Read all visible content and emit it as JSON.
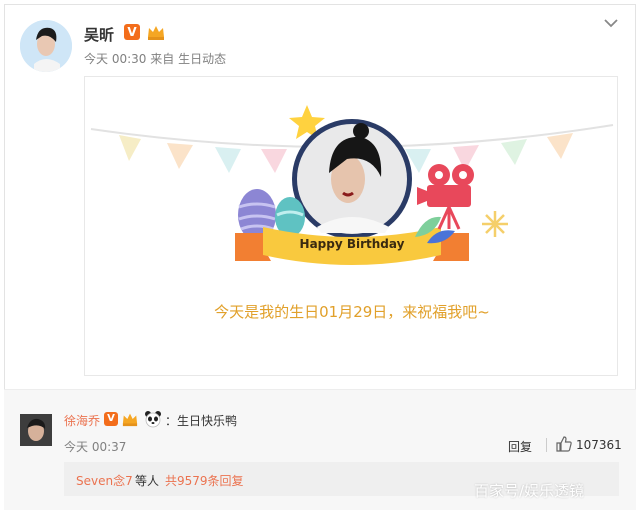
{
  "post": {
    "author": "吴昕",
    "verified_badge": "V",
    "time": "今天 00:30",
    "source_prefix": "来自",
    "source": "生日动态",
    "options_icon": "chevron-down-icon"
  },
  "card": {
    "banner_text": "Happy Birthday",
    "message": "今天是我的生日01月29日，来祝福我吧~"
  },
  "comment": {
    "author": "徐海乔",
    "verified_badge": "V",
    "text": "：生日快乐鸭",
    "time": "今天 00:37",
    "reply_label": "回复",
    "like_count": "107361",
    "replies_user": "Seven念7",
    "replies_mid": " 等人",
    "replies_total": "共9579条回复"
  },
  "watermark": "百家号/娱乐透镜",
  "colors": {
    "accent": "#eb7350",
    "verified": "#f36d1b",
    "birthday_text": "#e1a02a"
  }
}
